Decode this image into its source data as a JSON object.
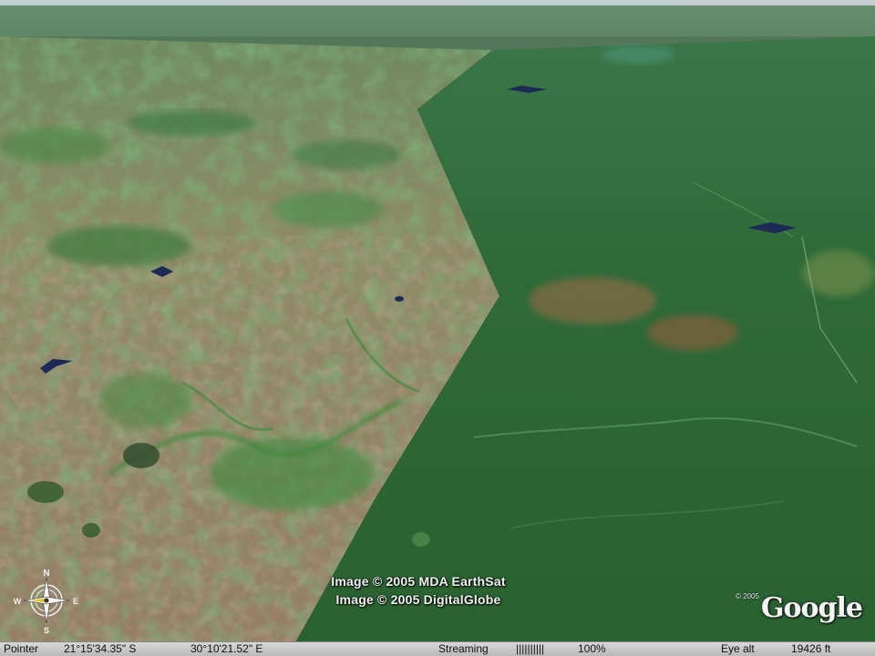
{
  "credits": {
    "line1": "Image © 2005 MDA EarthSat",
    "line2": "Image © 2005 DigitalGlobe"
  },
  "logo": {
    "year": "© 2005",
    "word": "Google"
  },
  "compass": {
    "north": "N",
    "east": "E",
    "south": "S",
    "west": "W"
  },
  "status": {
    "pointer_label": "Pointer",
    "lat": "21°15'34.35\" S",
    "lon": "30°10'21.52\" E",
    "streaming_label": "Streaming",
    "streaming_bars": "||||||||||",
    "streaming_percent": "100%",
    "eye_label": "Eye alt",
    "eye_value": "19426 ft"
  },
  "icons": {
    "compass": "compass-rose-icon"
  },
  "colors": {
    "forest": "#2f6b34",
    "savanna": "#8b8560",
    "statusbar": "#c8c8c8"
  }
}
